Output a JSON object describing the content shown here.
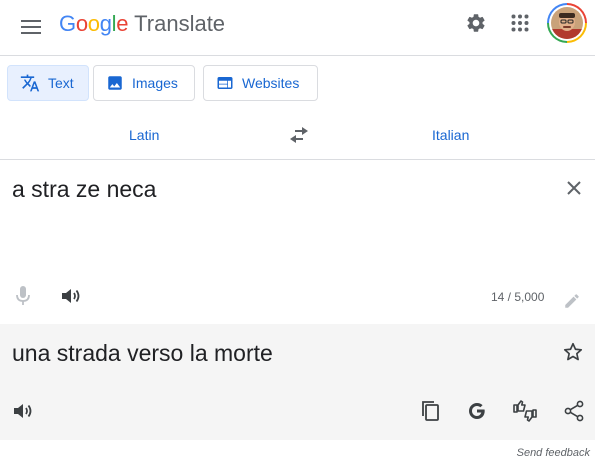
{
  "header": {
    "logo_text": "Google",
    "product_name": "Translate",
    "icons": [
      "menu-icon",
      "gear-icon",
      "apps-grid-icon",
      "avatar"
    ]
  },
  "modes": {
    "tabs": [
      {
        "label": "Text",
        "icon": "translate-icon",
        "active": true
      },
      {
        "label": "Images",
        "icon": "image-icon",
        "active": false
      },
      {
        "label": "Websites",
        "icon": "website-icon",
        "active": false
      }
    ]
  },
  "languages": {
    "source": "Latin",
    "target": "Italian"
  },
  "source": {
    "text": "a stra ze neca",
    "char_count": "14 / 5,000"
  },
  "target": {
    "text": "una strada verso la morte"
  },
  "footer": {
    "feedback": "Send feedback"
  },
  "colors": {
    "accent": "#1967d2",
    "active_tab_bg": "#e8f0fe",
    "target_panel_bg": "#f5f5f5",
    "icon_gray": "#5f6368"
  }
}
